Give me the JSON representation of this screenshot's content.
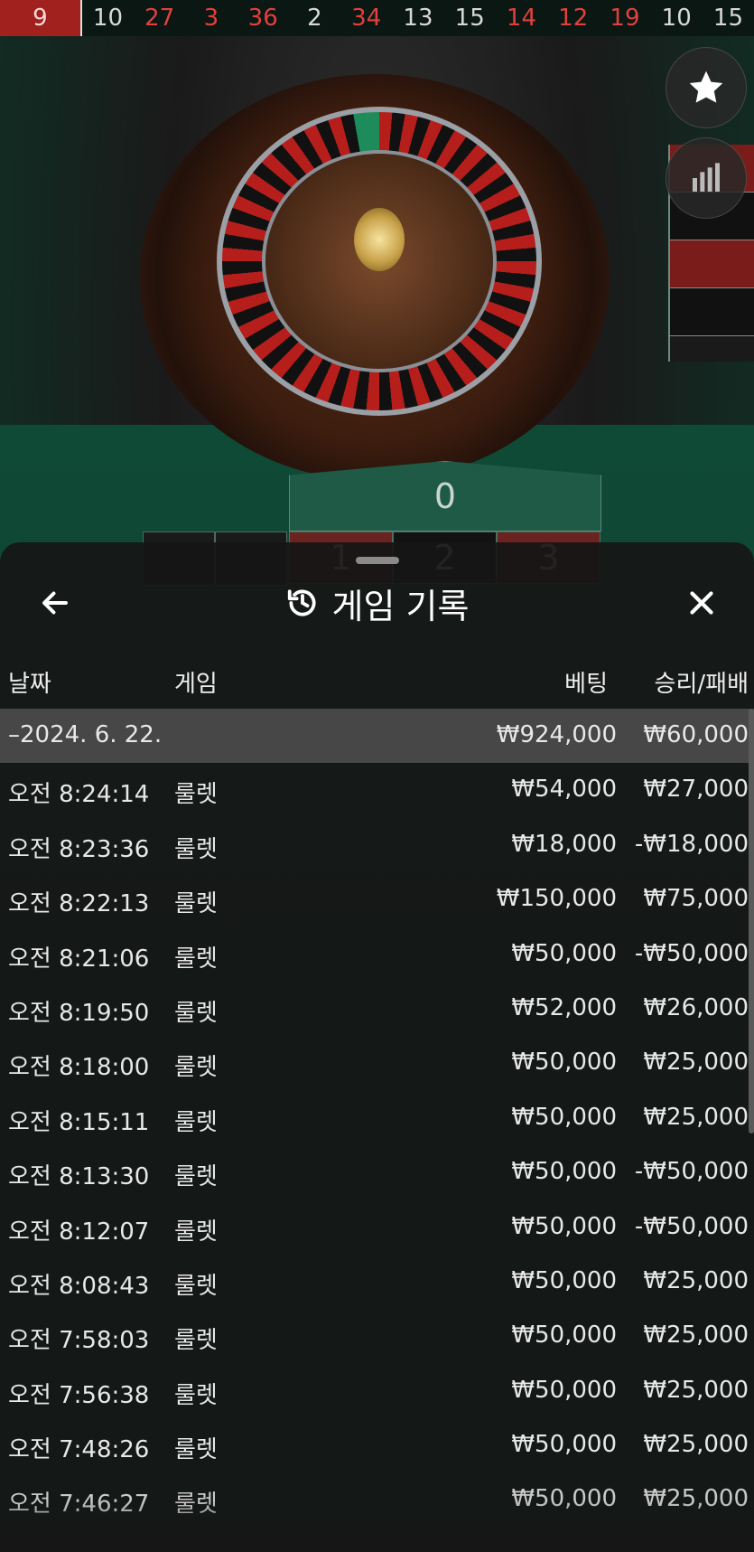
{
  "results_strip": [
    {
      "n": "9",
      "color": "red"
    },
    {
      "n": "10",
      "color": "black"
    },
    {
      "n": "27",
      "color": "red"
    },
    {
      "n": "3",
      "color": "red"
    },
    {
      "n": "36",
      "color": "red"
    },
    {
      "n": "2",
      "color": "black"
    },
    {
      "n": "34",
      "color": "red"
    },
    {
      "n": "13",
      "color": "black"
    },
    {
      "n": "15",
      "color": "black"
    },
    {
      "n": "14",
      "color": "red"
    },
    {
      "n": "12",
      "color": "red"
    },
    {
      "n": "19",
      "color": "red"
    },
    {
      "n": "10",
      "color": "black"
    },
    {
      "n": "15",
      "color": "black"
    }
  ],
  "table": {
    "zero": "0",
    "first_row": [
      "1",
      "2",
      "3"
    ]
  },
  "icons": {
    "favorite": "star-icon",
    "statistics": "stats-icon",
    "back": "arrow-left-icon",
    "history": "history-icon",
    "close": "close-icon"
  },
  "sheet": {
    "title": "게임 기록",
    "columns": {
      "date": "날짜",
      "game": "게임",
      "bet": "베팅",
      "win_loss": "승리/패배"
    },
    "summary": {
      "date": "–2024. 6. 22.",
      "bet": "₩924,000",
      "win_loss": "₩60,000"
    },
    "rows": [
      {
        "time": "오전 8:24:14",
        "game": "룰렛",
        "bet": "₩54,000",
        "win_loss": "₩27,000"
      },
      {
        "time": "오전 8:23:36",
        "game": "룰렛",
        "bet": "₩18,000",
        "win_loss": "-₩18,000"
      },
      {
        "time": "오전 8:22:13",
        "game": "룰렛",
        "bet": "₩150,000",
        "win_loss": "₩75,000"
      },
      {
        "time": "오전 8:21:06",
        "game": "룰렛",
        "bet": "₩50,000",
        "win_loss": "-₩50,000"
      },
      {
        "time": "오전 8:19:50",
        "game": "룰렛",
        "bet": "₩52,000",
        "win_loss": "₩26,000"
      },
      {
        "time": "오전 8:18:00",
        "game": "룰렛",
        "bet": "₩50,000",
        "win_loss": "₩25,000"
      },
      {
        "time": "오전 8:15:11",
        "game": "룰렛",
        "bet": "₩50,000",
        "win_loss": "₩25,000"
      },
      {
        "time": "오전 8:13:30",
        "game": "룰렛",
        "bet": "₩50,000",
        "win_loss": "-₩50,000"
      },
      {
        "time": "오전 8:12:07",
        "game": "룰렛",
        "bet": "₩50,000",
        "win_loss": "-₩50,000"
      },
      {
        "time": "오전 8:08:43",
        "game": "룰렛",
        "bet": "₩50,000",
        "win_loss": "₩25,000"
      },
      {
        "time": "오전 7:58:03",
        "game": "룰렛",
        "bet": "₩50,000",
        "win_loss": "₩25,000"
      },
      {
        "time": "오전 7:56:38",
        "game": "룰렛",
        "bet": "₩50,000",
        "win_loss": "₩25,000"
      },
      {
        "time": "오전 7:48:26",
        "game": "룰렛",
        "bet": "₩50,000",
        "win_loss": "₩25,000"
      },
      {
        "time": "오전 7:46:27",
        "game": "룰렛",
        "bet": "₩50,000",
        "win_loss": "₩25,000"
      }
    ]
  }
}
